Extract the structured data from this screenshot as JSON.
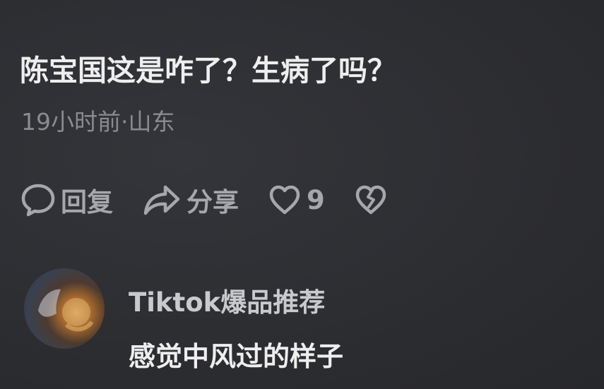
{
  "comment": {
    "text": "陈宝国这是咋了？生病了吗？",
    "meta": "19小时前·山东"
  },
  "actions": {
    "reply_label": "回复",
    "reply_icon": "speech-bubble-icon",
    "share_label": "分享",
    "share_icon": "share-arrow-icon",
    "like_count": "9",
    "like_icon": "heart-outline-icon",
    "dislike_icon": "broken-heart-icon"
  },
  "reply": {
    "author": "Tiktok爆品推荐",
    "text": "感觉中风过的样子"
  },
  "colors": {
    "background": "#2d2e32",
    "primary_text": "#eeeeee",
    "secondary_text": "#8a8b90",
    "action_text": "#a6a7ac"
  }
}
